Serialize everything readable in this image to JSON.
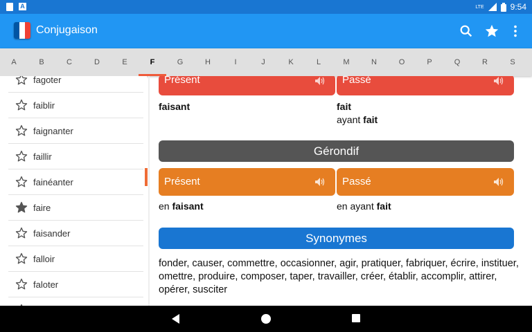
{
  "status_bar": {
    "time": "9:54",
    "network": "LTE"
  },
  "app_bar": {
    "title": "Conjugaison",
    "icons": [
      "search-icon",
      "star-icon",
      "more-vert-icon"
    ],
    "flag_colors": [
      "#0055A4",
      "#FFFFFF",
      "#EF4135"
    ]
  },
  "letters": {
    "items": [
      "A",
      "B",
      "C",
      "D",
      "E",
      "F",
      "G",
      "H",
      "I",
      "J",
      "K",
      "L",
      "M",
      "N",
      "O",
      "P",
      "Q",
      "R",
      "S"
    ],
    "selected": "F",
    "accent": "#ef5b3a"
  },
  "sidebar": {
    "items": [
      {
        "label": "fagoter",
        "starred": false
      },
      {
        "label": "faiblir",
        "starred": false
      },
      {
        "label": "faignanter",
        "starred": false
      },
      {
        "label": "faillir",
        "starred": false
      },
      {
        "label": "fainéanter",
        "starred": false
      },
      {
        "label": "faire",
        "starred": true
      },
      {
        "label": "faisander",
        "starred": false
      },
      {
        "label": "falloir",
        "starred": false
      },
      {
        "label": "faloter",
        "starred": false
      }
    ]
  },
  "participe": {
    "present_label": "Présent",
    "past_label": "Passé",
    "present_form_bold": "faisant",
    "past_form_bold": "fait",
    "past_compound_prefix": "ayant ",
    "past_compound_bold": "ait",
    "past_compound_stem": "f"
  },
  "gerondif": {
    "title": "Gérondif",
    "present_label": "Présent",
    "past_label": "Passé",
    "present_prefix": "en ",
    "present_stem": "f",
    "present_bold": "aisant",
    "past_prefix": "en ayant ",
    "past_stem": "f",
    "past_bold": "ait"
  },
  "synonyms": {
    "title": "Synonymes",
    "text": "fonder, causer, commettre, occasionner, agir, pratiquer, fabriquer, écrire, instituer, omettre, produire, composer, taper, travailler, créer, établir, accomplir, attirer, opérer, susciter"
  },
  "colors": {
    "primary": "#2196f3",
    "primary_dark": "#1976d2",
    "present_header": "#e84c3d",
    "gerondif_header": "#e67e22",
    "section_gray": "#555555",
    "synonyms_blue": "#1976d2"
  }
}
